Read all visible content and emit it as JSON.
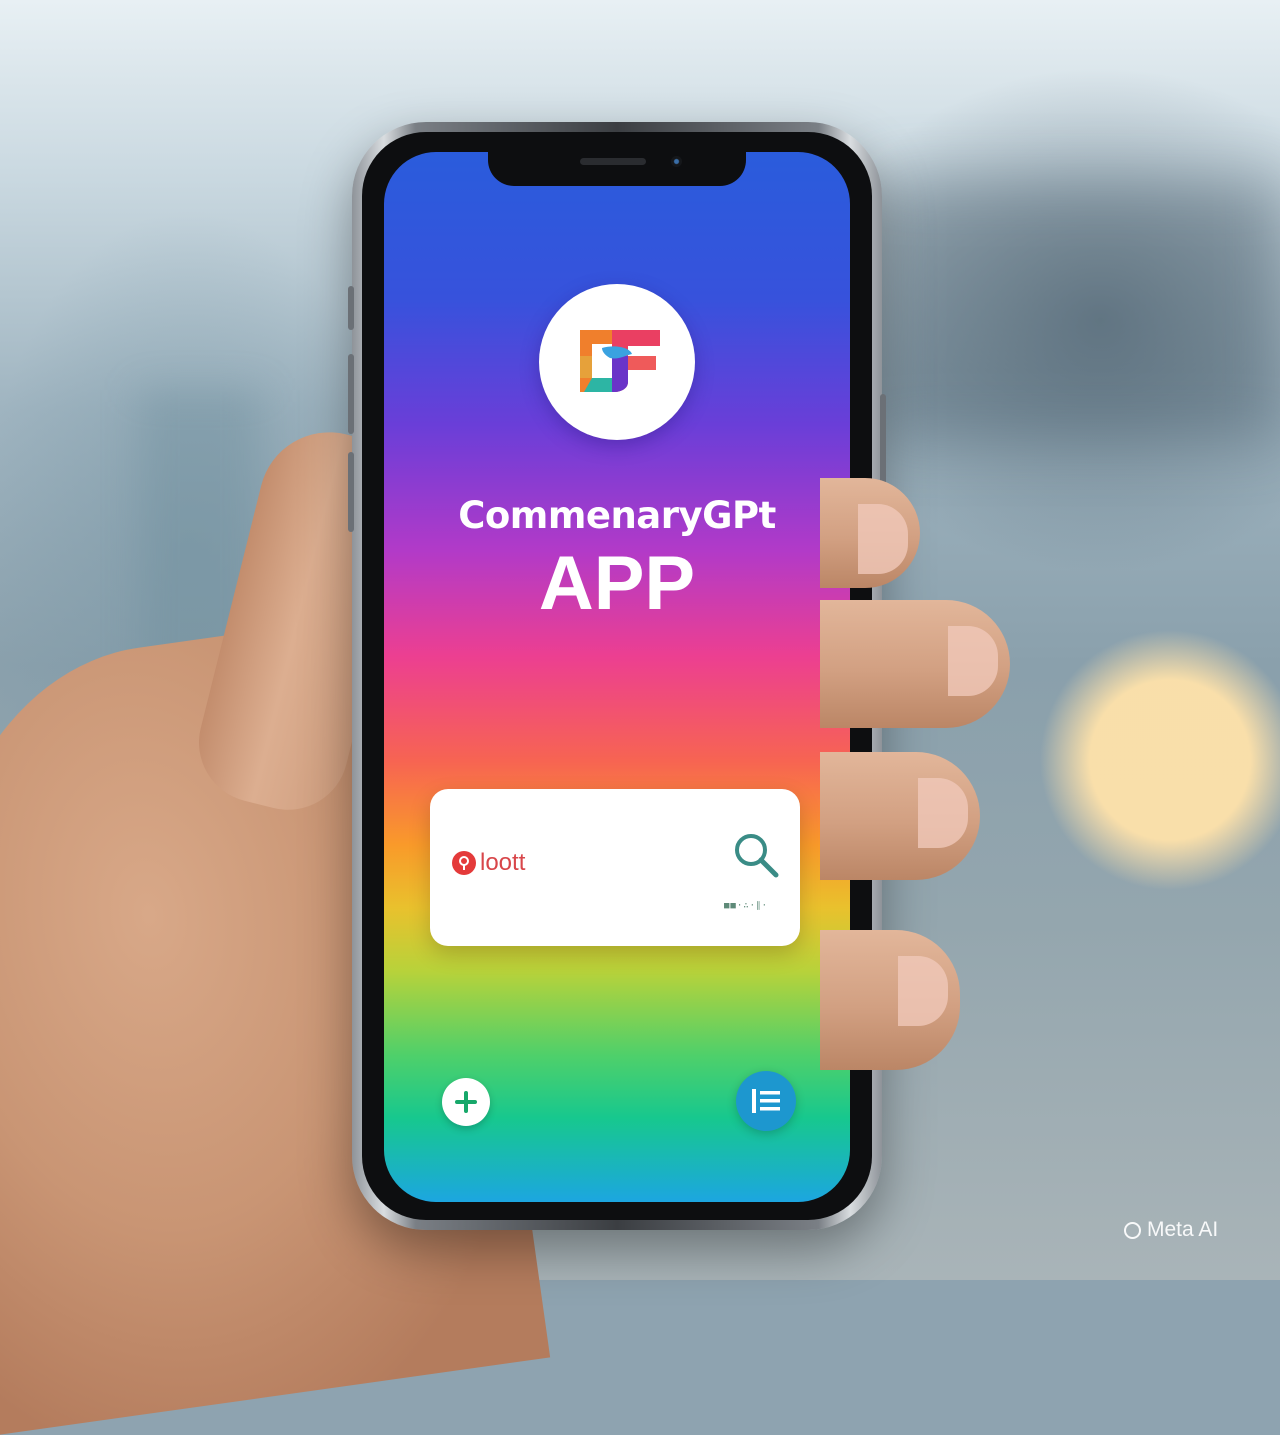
{
  "app": {
    "name": "CommenaryGPt",
    "subtitle": "APP",
    "logo_text": "CF"
  },
  "search": {
    "value": "loott",
    "meta": "■■·∴·∥·"
  },
  "buttons": {
    "add_icon": "plus-icon",
    "menu_icon": "list-icon"
  },
  "watermark": {
    "text": "Meta AI"
  },
  "colors": {
    "screen_gradient": [
      "#2a5cdc",
      "#b23ac8",
      "#ec3f91",
      "#f99a2a",
      "#4fd06a",
      "#1ca6e0"
    ],
    "search_text": "#d8464a",
    "search_icon": "#3a8c86",
    "menu_button": "#1d97cf",
    "add_icon": "#17a86a"
  }
}
